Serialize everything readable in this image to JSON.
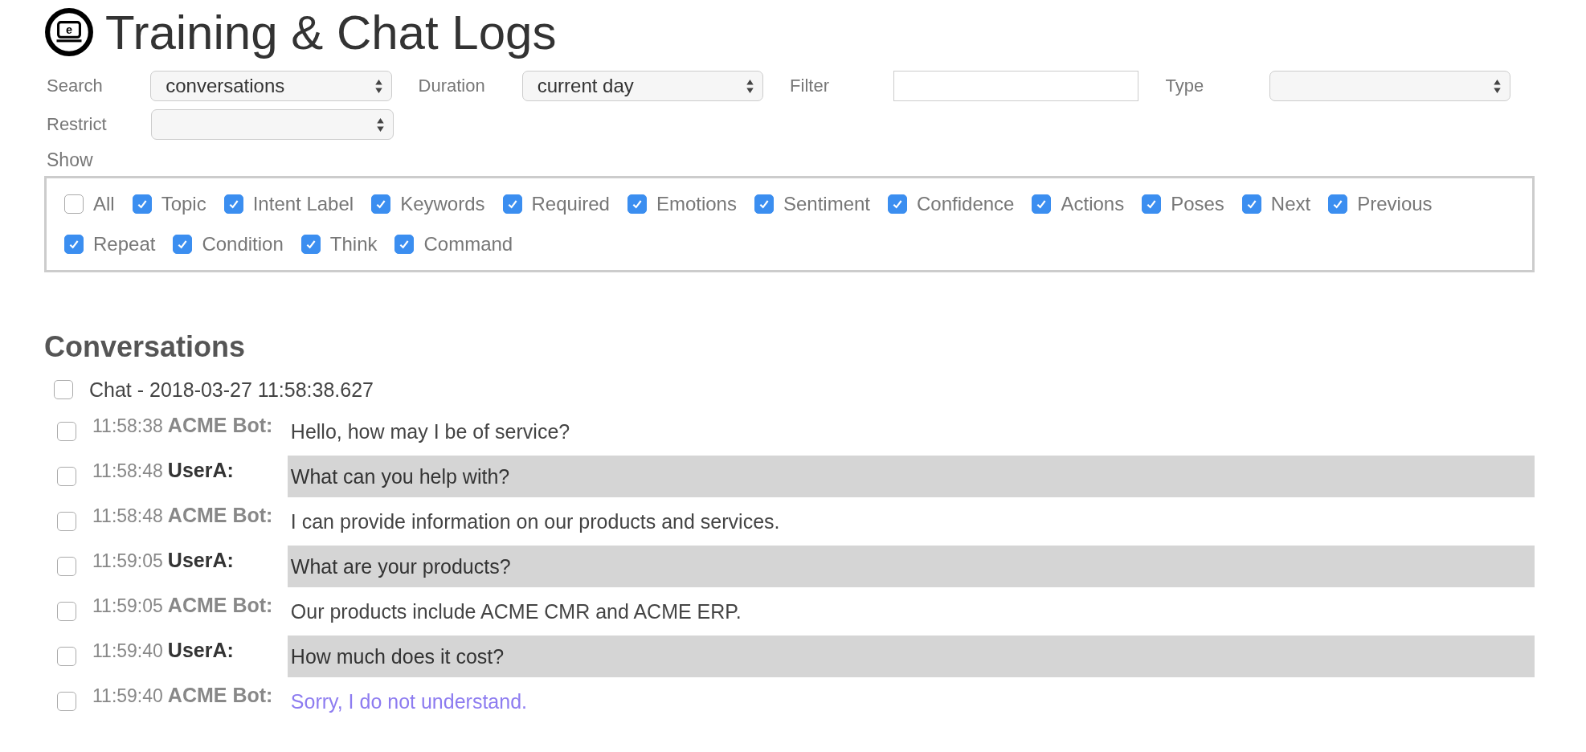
{
  "header": {
    "logo_text": "e",
    "title": "Training & Chat Logs"
  },
  "filters": [
    {
      "label": "Search",
      "kind": "select",
      "value": "conversations"
    },
    {
      "label": "Duration",
      "kind": "select",
      "value": "current day"
    },
    {
      "label": "Filter",
      "kind": "text"
    },
    {
      "label": "Type",
      "kind": "select"
    },
    {
      "label": "Restrict",
      "kind": "select"
    }
  ],
  "show": {
    "label": "Show",
    "options": [
      {
        "label": "All",
        "checked": false
      },
      {
        "label": "Topic",
        "checked": true
      },
      {
        "label": "Intent Label",
        "checked": true
      },
      {
        "label": "Keywords",
        "checked": true
      },
      {
        "label": "Required",
        "checked": true
      },
      {
        "label": "Emotions",
        "checked": true
      },
      {
        "label": "Sentiment",
        "checked": true
      },
      {
        "label": "Confidence",
        "checked": true
      },
      {
        "label": "Actions",
        "checked": true
      },
      {
        "label": "Poses",
        "checked": true
      },
      {
        "label": "Next",
        "checked": true
      },
      {
        "label": "Previous",
        "checked": true
      },
      {
        "label": "Repeat",
        "checked": true
      },
      {
        "label": "Condition",
        "checked": true
      },
      {
        "label": "Think",
        "checked": true
      },
      {
        "label": "Command",
        "checked": true
      }
    ]
  },
  "conversations": {
    "title": "Conversations",
    "chat": {
      "label": "Chat - 2018-03-27 11:58:38.627",
      "checked": false
    },
    "messages": [
      {
        "time": "11:58:38",
        "speaker": "ACME Bot:",
        "kind": "bot",
        "text": "Hello, how may I be of service?",
        "checked": false
      },
      {
        "time": "11:58:48",
        "speaker": "UserA:",
        "kind": "user",
        "text": "What can you help with?",
        "checked": false
      },
      {
        "time": "11:58:48",
        "speaker": "ACME Bot:",
        "kind": "bot",
        "text": "I can provide information on our products and services.",
        "checked": false
      },
      {
        "time": "11:59:05",
        "speaker": "UserA:",
        "kind": "user",
        "text": "What are your products?",
        "checked": false
      },
      {
        "time": "11:59:05",
        "speaker": "ACME Bot:",
        "kind": "bot",
        "text": "Our products include ACME CMR and ACME ERP.",
        "checked": false
      },
      {
        "time": "11:59:40",
        "speaker": "UserA:",
        "kind": "user",
        "text": "How much does it cost?",
        "checked": false
      },
      {
        "time": "11:59:40",
        "speaker": "ACME Bot:",
        "kind": "fallback",
        "text": "Sorry, I do not understand.",
        "checked": false
      }
    ]
  }
}
